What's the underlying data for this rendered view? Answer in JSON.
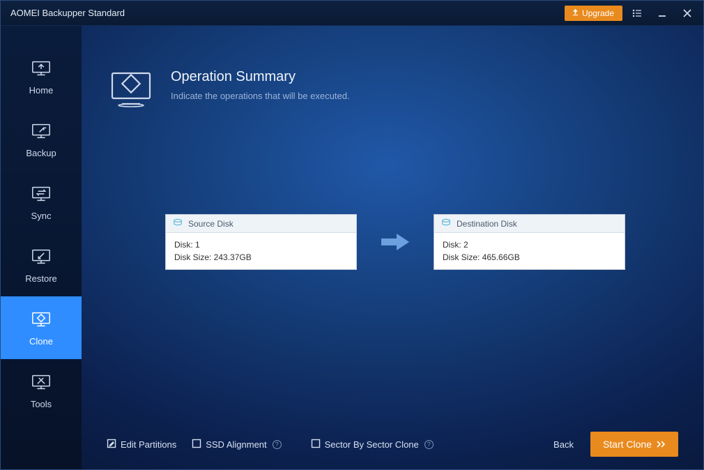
{
  "titlebar": {
    "title": "AOMEI Backupper Standard",
    "upgrade_label": "Upgrade"
  },
  "sidebar": {
    "items": [
      {
        "label": "Home"
      },
      {
        "label": "Backup"
      },
      {
        "label": "Sync"
      },
      {
        "label": "Restore"
      },
      {
        "label": "Clone"
      },
      {
        "label": "Tools"
      }
    ],
    "active_index": 4
  },
  "header": {
    "title": "Operation Summary",
    "subtitle": "Indicate the operations that will be executed."
  },
  "source": {
    "head_label": "Source Disk",
    "disk_label": "Disk: 1",
    "size_label": "Disk Size: 243.37GB"
  },
  "destination": {
    "head_label": "Destination Disk",
    "disk_label": "Disk: 2",
    "size_label": "Disk Size: 465.66GB"
  },
  "footer": {
    "edit_partitions": "Edit Partitions",
    "ssd_alignment": "SSD Alignment",
    "sector_by_sector": "Sector By Sector Clone",
    "back": "Back",
    "start": "Start Clone"
  }
}
